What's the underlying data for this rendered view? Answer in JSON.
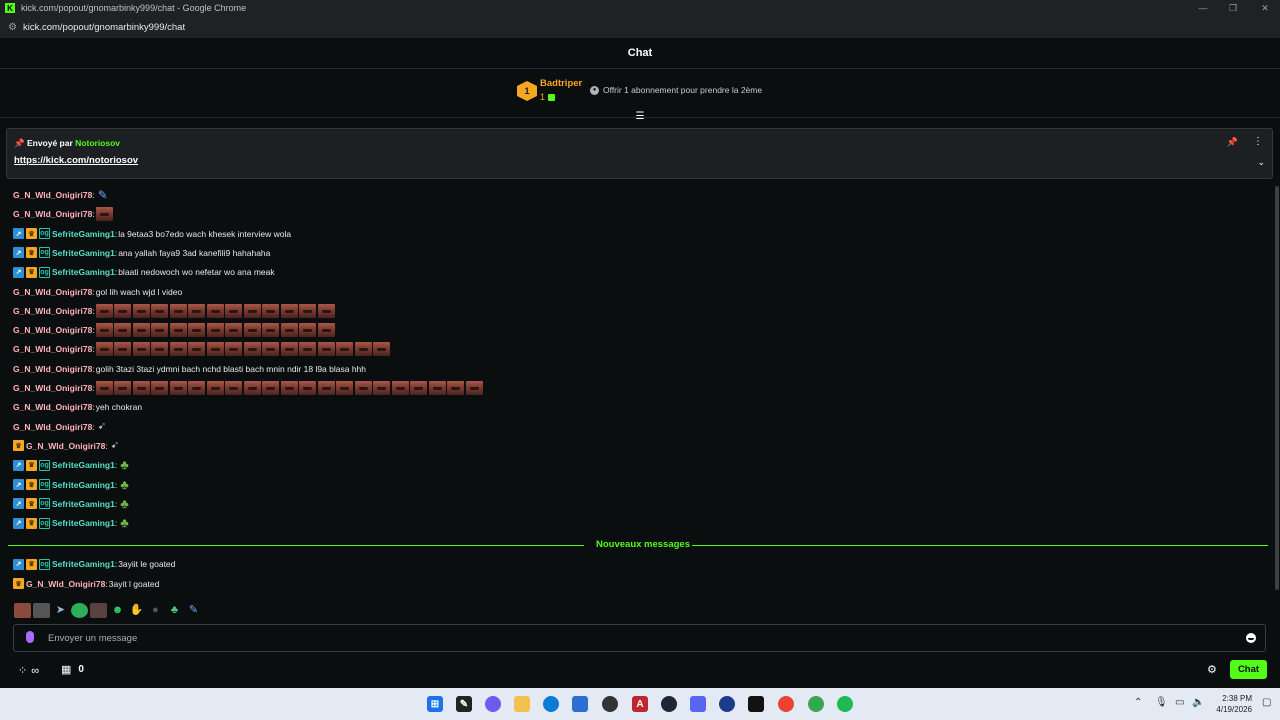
{
  "window": {
    "title": "kick.com/popout/gnomarbinky999/chat - Google Chrome",
    "url": "kick.com/popout/gnomarbinky999/chat"
  },
  "header": {
    "title": "Chat"
  },
  "gift": {
    "rank": "1",
    "name": "Badtriper",
    "count": "1",
    "offer": "Offrir 1 abonnement pour prendre la 2ème"
  },
  "pinned": {
    "sent_by_prefix": "Envoyé par",
    "sent_by": "Notoriosov",
    "link": "https://kick.com/notoriosov"
  },
  "messages": [
    {
      "user": "G_N_Wld_Onigiri78",
      "badges": [],
      "text": "",
      "emotes": "feather"
    },
    {
      "user": "G_N_Wld_Onigiri78",
      "badges": [],
      "text": "",
      "emotes": "1"
    },
    {
      "user": "SefriteGaming1",
      "badges": [
        "vip",
        "sub",
        "og"
      ],
      "text": "la 9etaa3 bo7edo wach khesek interview wola"
    },
    {
      "user": "SefriteGaming1",
      "badges": [
        "vip",
        "sub",
        "og"
      ],
      "text": "ana yallah faya9 3ad kanefili9 hahahaha"
    },
    {
      "user": "SefriteGaming1",
      "badges": [
        "vip",
        "sub",
        "og"
      ],
      "text": "blaati nedowoch wo nefetar wo ana meak"
    },
    {
      "user": "G_N_Wld_Onigiri78",
      "badges": [],
      "text": "gol lih wach wjd l video"
    },
    {
      "user": "G_N_Wld_Onigiri78",
      "badges": [],
      "text": "",
      "emotes": "13"
    },
    {
      "user": "G_N_Wld_Onigiri78",
      "badges": [],
      "text": "",
      "emotes": "13"
    },
    {
      "user": "G_N_Wld_Onigiri78",
      "badges": [],
      "text": "",
      "emotes": "16"
    },
    {
      "user": "G_N_Wld_Onigiri78",
      "badges": [],
      "text": "golih 3tazi 3tazi ydmni bach nchd blasti bach mnin ndir 18 l9a blasa hhh"
    },
    {
      "user": "G_N_Wld_Onigiri78",
      "badges": [],
      "text": "",
      "emotes": "21"
    },
    {
      "user": "G_N_Wld_Onigiri78",
      "badges": [],
      "text": "yeh chokran"
    },
    {
      "user": "G_N_Wld_Onigiri78",
      "badges": [],
      "text": "",
      "emotes": "small"
    },
    {
      "user": "G_N_Wld_Onigiri78",
      "badges": [
        "sub"
      ],
      "text": "",
      "emotes": "small"
    },
    {
      "user": "SefriteGaming1",
      "badges": [
        "vip",
        "sub",
        "og"
      ],
      "text": "",
      "emotes": "frog"
    },
    {
      "user": "SefriteGaming1",
      "badges": [
        "vip",
        "sub",
        "og"
      ],
      "text": "",
      "emotes": "frog"
    },
    {
      "user": "SefriteGaming1",
      "badges": [
        "vip",
        "sub",
        "og"
      ],
      "text": "",
      "emotes": "frog"
    },
    {
      "user": "SefriteGaming1",
      "badges": [
        "vip",
        "sub",
        "og"
      ],
      "text": "",
      "emotes": "frog"
    }
  ],
  "new_messages_label": "Nouveaux messages",
  "new_messages": [
    {
      "user": "SefriteGaming1",
      "badges": [
        "vip",
        "sub",
        "og"
      ],
      "text": "3ayiit le goated"
    },
    {
      "user": "G_N_Wld_Onigiri78",
      "badges": [
        "sub"
      ],
      "text": "3ayit l goated"
    }
  ],
  "input": {
    "placeholder": "Envoyer un message"
  },
  "footer": {
    "viewers": "∞",
    "gift_count": "0",
    "chat_button": "Chat"
  },
  "taskbar": {
    "time": "2:38 PM",
    "date": "4/19/2026"
  },
  "colors": {
    "accent": "#53fc18",
    "vip": "#2f8fd5",
    "sub": "#f5a623",
    "og": "#27c3a8",
    "user_gn": "#ffb3b8",
    "user_sef": "#55e0c7"
  }
}
